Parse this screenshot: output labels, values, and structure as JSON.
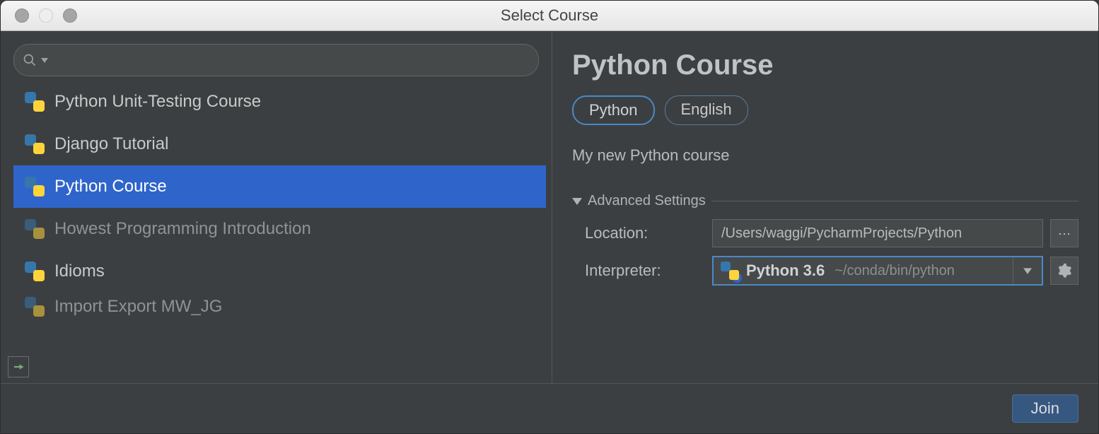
{
  "window": {
    "title": "Select Course"
  },
  "search": {
    "value": "",
    "placeholder": ""
  },
  "courses": [
    {
      "label": "Python Unit-Testing Course",
      "state": "normal"
    },
    {
      "label": "Django Tutorial",
      "state": "normal"
    },
    {
      "label": "Python Course",
      "state": "selected"
    },
    {
      "label": "Howest Programming Introduction",
      "state": "dim"
    },
    {
      "label": "Idioms",
      "state": "normal"
    },
    {
      "label": "Import Export MW_JG",
      "state": "dim"
    }
  ],
  "details": {
    "title": "Python Course",
    "tags": {
      "language": "Python",
      "human_language": "English"
    },
    "description": "My new Python course",
    "advanced_label": "Advanced Settings",
    "location_label": "Location:",
    "location_value": "/Users/waggi/PycharmProjects/Python",
    "interpreter_label": "Interpreter:",
    "interpreter_name": "Python 3.6",
    "interpreter_path": "~/conda/bin/python"
  },
  "footer": {
    "join_label": "Join"
  }
}
